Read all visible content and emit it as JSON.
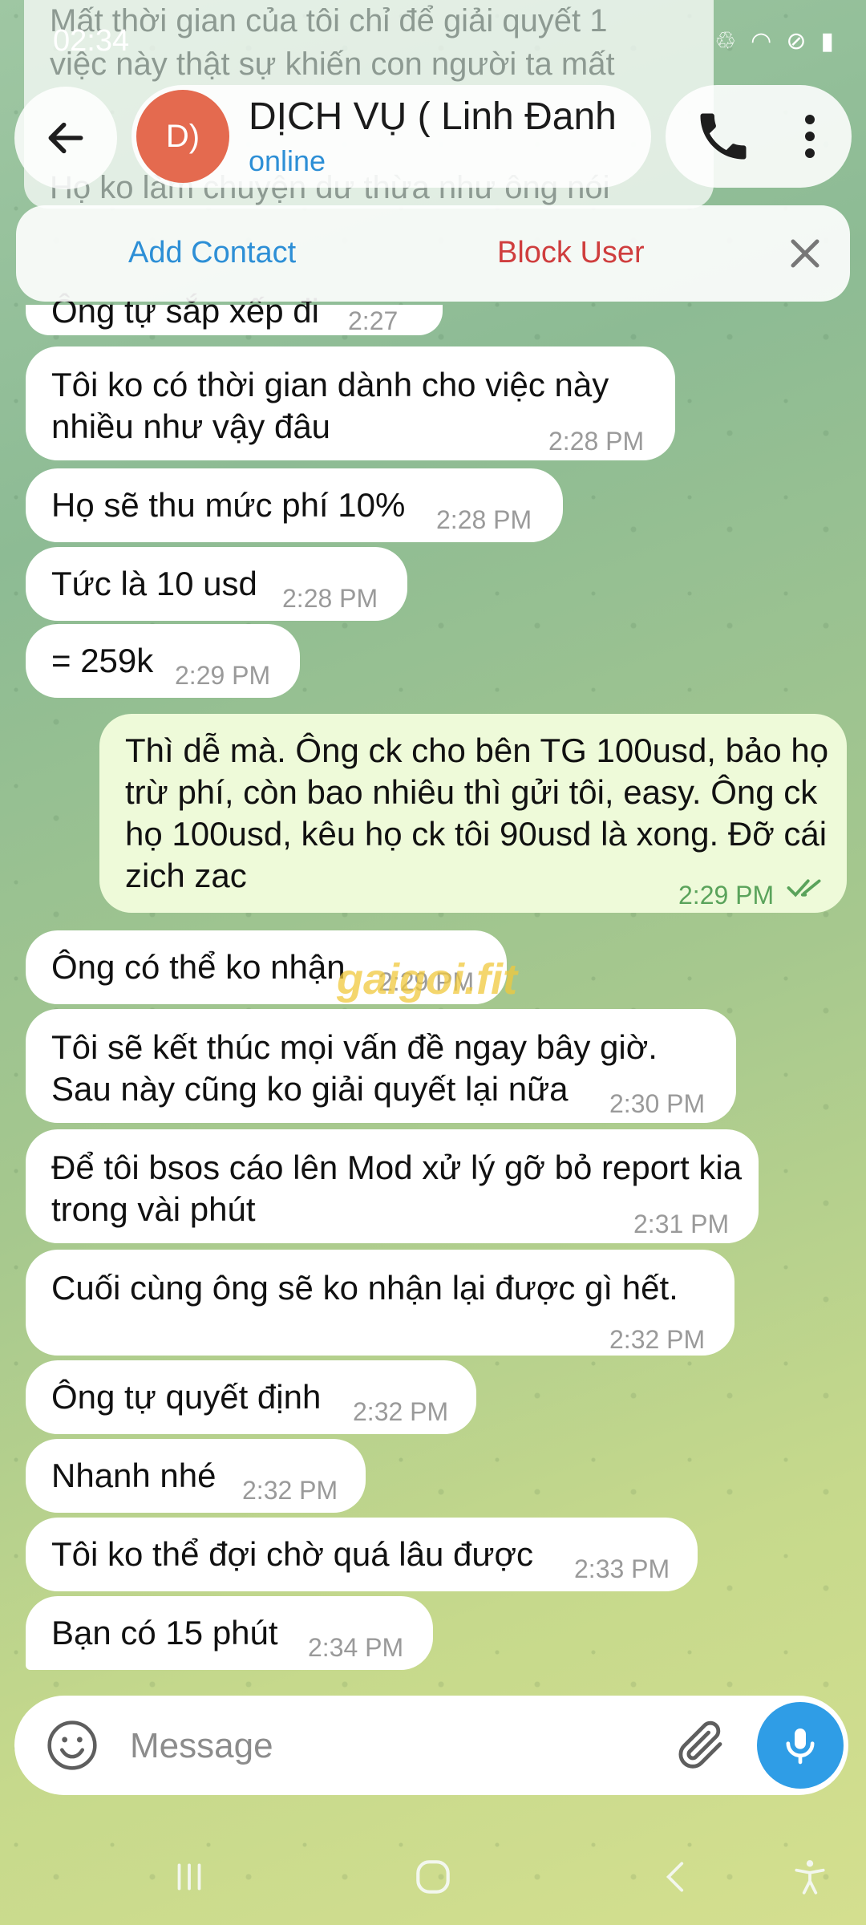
{
  "status_bar": {
    "time": "02:34"
  },
  "ghost_messages": [
    "Mất thời gian của tôi chỉ để giải quyết 1",
    "việc này thật sự khiến con người ta mất",
    "Họ ko làm chuyện dư thừa như ông nói"
  ],
  "header": {
    "avatar_initials": "D)",
    "chat_name": "DỊCH VỤ ( Linh Đanh",
    "status": "online"
  },
  "contact_bar": {
    "add_contact": "Add Contact",
    "block_user": "Block User"
  },
  "messages": [
    {
      "text": "Ông tự sắp xếp đi",
      "time": "2:27 PM"
    },
    {
      "text": "Tôi ko có thời gian dành cho việc này nhiều như vậy đâu",
      "time": "2:28 PM"
    },
    {
      "text": "Họ sẽ thu mức phí 10%",
      "time": "2:28 PM"
    },
    {
      "text": "Tức là 10 usd",
      "time": "2:28 PM"
    },
    {
      "text": "= 259k",
      "time": "2:29 PM"
    },
    {
      "text": "Thì dễ mà. Ông ck cho bên TG 100usd, bảo họ trừ phí, còn bao nhiêu thì gửi tôi, easy. Ông ck họ 100usd, kêu họ ck tôi 90usd là xong. Đỡ cái zich zac",
      "time": "2:29 PM"
    },
    {
      "text": "Ông có thể ko nhận",
      "time": "2:29 PM"
    },
    {
      "text": "Tôi sẽ kết thúc mọi vấn đề ngay bây giờ. Sau này cũng ko giải quyết lại nữa",
      "time": "2:30 PM"
    },
    {
      "text": "Để tôi bsos cáo lên Mod xử lý gỡ bỏ report kia trong vài phút",
      "time": "2:31 PM"
    },
    {
      "text": "Cuối cùng ông sẽ ko nhận lại được gì hết.",
      "time": "2:32 PM"
    },
    {
      "text": "Ông tự quyết định",
      "time": "2:32 PM"
    },
    {
      "text": "Nhanh nhé",
      "time": "2:32 PM"
    },
    {
      "text": "Tôi ko thể đợi chờ quá lâu được",
      "time": "2:33 PM"
    },
    {
      "text": "Bạn có 15 phút",
      "time": "2:34 PM"
    }
  ],
  "watermark": "gaigoi.fit",
  "input": {
    "placeholder": "Message"
  }
}
